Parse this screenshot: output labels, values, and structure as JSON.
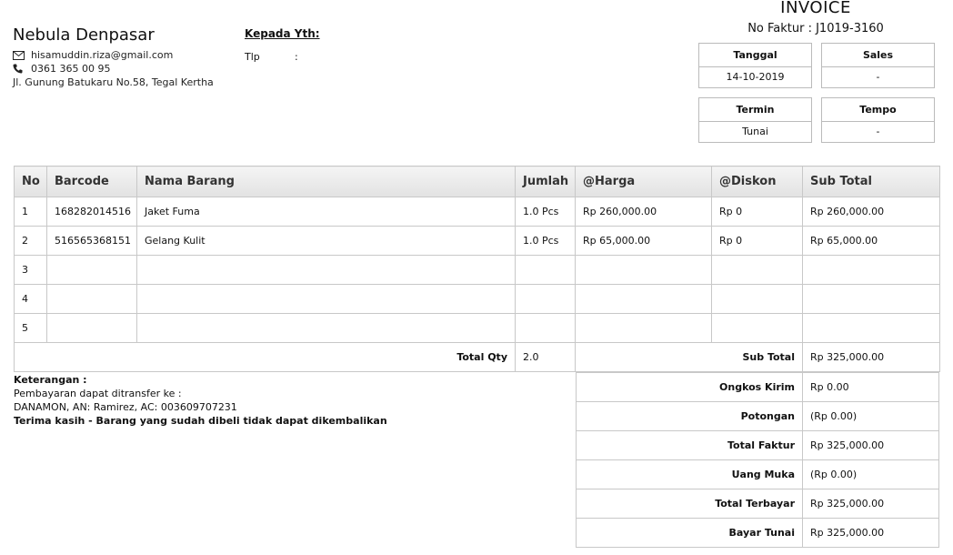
{
  "seller": {
    "name": "Nebula Denpasar",
    "email": "hisamuddin.riza@gmail.com",
    "phone": "0361 365 00 95",
    "address": "Jl. Gunung Batukaru No.58, Tegal Kertha",
    "email_icon": "envelope-icon",
    "phone_icon": "phone-icon"
  },
  "recipient": {
    "label": "Kepada Yth:",
    "tlp_label": "Tlp",
    "tlp_colon": ":"
  },
  "invoice": {
    "title": "INVOICE",
    "number_text": "No Faktur : J1019-3160",
    "tanggal_label": "Tanggal",
    "tanggal": "14-10-2019",
    "sales_label": "Sales",
    "sales": "-",
    "termin_label": "Termin",
    "termin": "Tunai",
    "tempo_label": "Tempo",
    "tempo": "-"
  },
  "table": {
    "headers": [
      "No",
      "Barcode",
      "Nama Barang",
      "Jumlah",
      "@Harga",
      "@Diskon",
      "Sub Total"
    ],
    "rows": [
      [
        "1",
        "168282014516",
        "Jaket Fuma",
        "1.0 Pcs",
        "Rp 260,000.00",
        "Rp 0",
        "Rp 260,000.00"
      ],
      [
        "2",
        "516565368151",
        "Gelang Kulit",
        "1.0 Pcs",
        "Rp 65,000.00",
        "Rp 0",
        "Rp 65,000.00"
      ],
      [
        "3",
        "",
        "",
        "",
        "",
        "",
        ""
      ],
      [
        "4",
        "",
        "",
        "",
        "",
        "",
        ""
      ],
      [
        "5",
        "",
        "",
        "",
        "",
        "",
        ""
      ]
    ],
    "total_qty_label": "Total Qty",
    "total_qty": "2.0",
    "subtotal_label": "Sub Total",
    "subtotal": "Rp 325,000.00"
  },
  "notes": {
    "label": "Keterangan :",
    "line1": "Pembayaran dapat ditransfer ke :",
    "line2": "DANAMON, AN: Ramirez, AC: 003609707231",
    "line3": "Terima kasih - Barang yang sudah dibeli tidak dapat dikembalikan"
  },
  "summary": [
    {
      "label": "Ongkos Kirim",
      "value": "Rp 0.00"
    },
    {
      "label": "Potongan",
      "value": "(Rp 0.00)"
    },
    {
      "label": "Total Faktur",
      "value": "Rp 325,000.00"
    },
    {
      "label": "Uang Muka",
      "value": "(Rp 0.00)"
    },
    {
      "label": "Total Terbayar",
      "value": "Rp 325,000.00"
    },
    {
      "label": "Bayar Tunai",
      "value": "Rp 325,000.00"
    }
  ]
}
